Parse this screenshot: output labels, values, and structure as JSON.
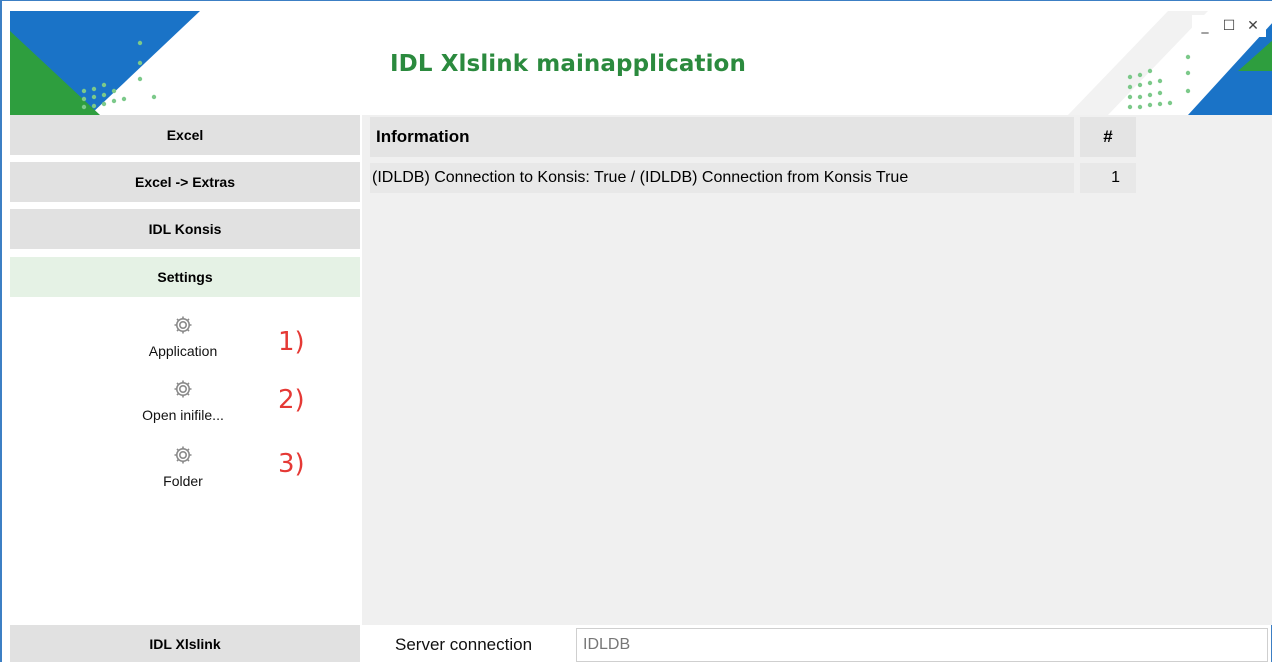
{
  "header": {
    "title": "IDL Xlslink mainapplication",
    "brand_green": "#2b8a3e",
    "brand_blue": "#1a73c7"
  },
  "window_controls": {
    "minimize": "_",
    "maximize": "☐",
    "close": "✕"
  },
  "sidebar": {
    "items": [
      {
        "label": "Excel"
      },
      {
        "label": "Excel -> Extras"
      },
      {
        "label": "IDL Konsis"
      },
      {
        "label": "Settings",
        "active": true
      }
    ],
    "tools": [
      {
        "label": "Application",
        "icon": "gear-icon",
        "annotation": "1)"
      },
      {
        "label": "Open inifile...",
        "icon": "gear-icon",
        "annotation": "2)"
      },
      {
        "label": "Folder",
        "icon": "gear-icon",
        "annotation": "3)"
      }
    ],
    "footer_label": "IDL Xlslink"
  },
  "grid": {
    "columns": [
      "Information",
      "#"
    ],
    "rows": [
      {
        "information": "(IDLDB) Connection to Konsis: True / (IDLDB) Connection from Konsis True",
        "num": "1"
      }
    ]
  },
  "server": {
    "label": "Server connection",
    "value": "IDLDB"
  }
}
